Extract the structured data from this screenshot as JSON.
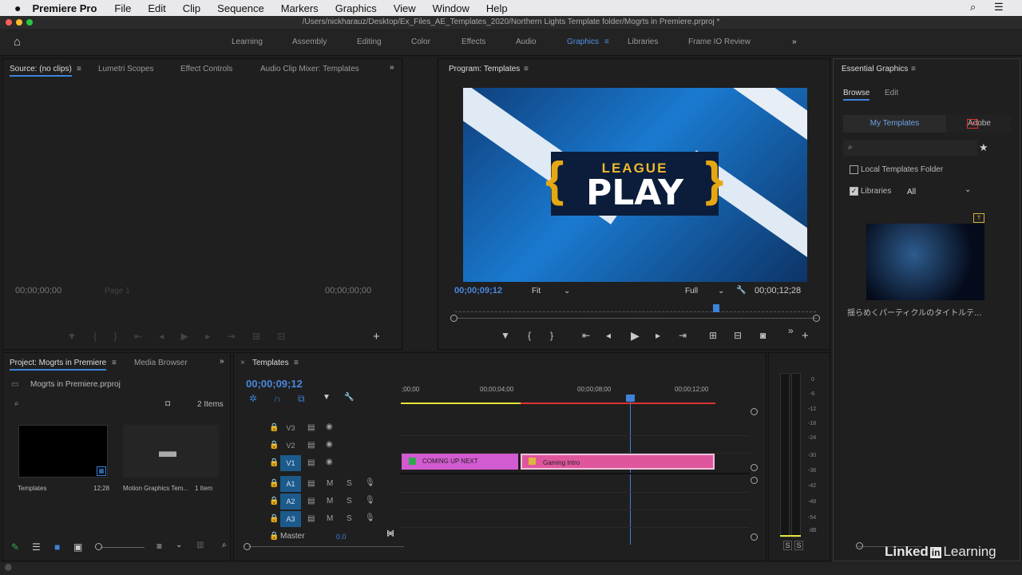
{
  "menubar": {
    "app": "Premiere Pro",
    "items": [
      "File",
      "Edit",
      "Clip",
      "Sequence",
      "Markers",
      "Graphics",
      "View",
      "Window",
      "Help"
    ]
  },
  "titlebar": {
    "path": "/Users/nickharauz/Desktop/Ex_Files_AE_Templates_2020/Northern Lights Template folder/Mogrts in Premiere.prproj *"
  },
  "workspaces": {
    "tabs": [
      "Learning",
      "Assembly",
      "Editing",
      "Color",
      "Effects",
      "Audio",
      "Graphics",
      "Libraries",
      "Frame IO Review"
    ],
    "active": "Graphics",
    "overflow": "»"
  },
  "source": {
    "tabs": [
      "Source: (no clips)",
      "Lumetri Scopes",
      "Effect Controls",
      "Audio Clip Mixer: Templates"
    ],
    "tc_left": "00;00;00;00",
    "tc_right": "00;00;00;00",
    "page": "Page 1"
  },
  "program": {
    "title": "Program: Templates",
    "tc_current": "00;00;09;12",
    "tc_duration": "00;00;12;28",
    "fit": "Fit",
    "quality": "Full",
    "graphic_top": "LEAGUE",
    "graphic_main": "PLAY"
  },
  "project": {
    "tabs": [
      "Project: Mogrts in Premiere",
      "Media Browser"
    ],
    "file": "Mogrts in Premiere.prproj",
    "count": "2 Items",
    "items": [
      {
        "name": "Templates",
        "duration": "12;28"
      },
      {
        "name": "Motion Graphics Tem...",
        "duration": "1 Item"
      }
    ]
  },
  "timeline": {
    "title": "Templates",
    "tc": "00;00;09;12",
    "ruler": [
      ";00;00",
      "00;00;04;00",
      "00;00;08;00",
      "00;00;12;00"
    ],
    "tracks": [
      {
        "name": "V3",
        "type": "video"
      },
      {
        "name": "V2",
        "type": "video"
      },
      {
        "name": "V1",
        "type": "video"
      },
      {
        "name": "A1",
        "type": "audio"
      },
      {
        "name": "A2",
        "type": "audio"
      },
      {
        "name": "A3",
        "type": "audio"
      }
    ],
    "master": "Master",
    "master_val": "0.0",
    "clips": [
      {
        "name": "COMING UP NEXT",
        "color": "#d35bd1"
      },
      {
        "name": "Gaming Intro",
        "color": "#e0569e"
      }
    ]
  },
  "meter": {
    "labels": [
      "0",
      "-6",
      "-12",
      "-18",
      "-24",
      "-30",
      "-36",
      "-42",
      "-48",
      "-54",
      "dB"
    ],
    "solo": [
      "S",
      "S"
    ]
  },
  "essential": {
    "title": "Essential Graphics",
    "tabs": [
      "Browse",
      "Edit"
    ],
    "source_tabs": [
      "My Templates",
      "Adobe"
    ],
    "local_folder": "Local Templates Folder",
    "libraries": "Libraries",
    "library_select": "All",
    "template_name": "揺らめくパーティクルのタイトルテ..."
  },
  "colors": {
    "accent": "#3d83d8",
    "clip_pink": "#d35bd1",
    "clip_rose": "#e0569e"
  },
  "branding": {
    "linkedin": "Linked",
    "learning": "Learning"
  }
}
